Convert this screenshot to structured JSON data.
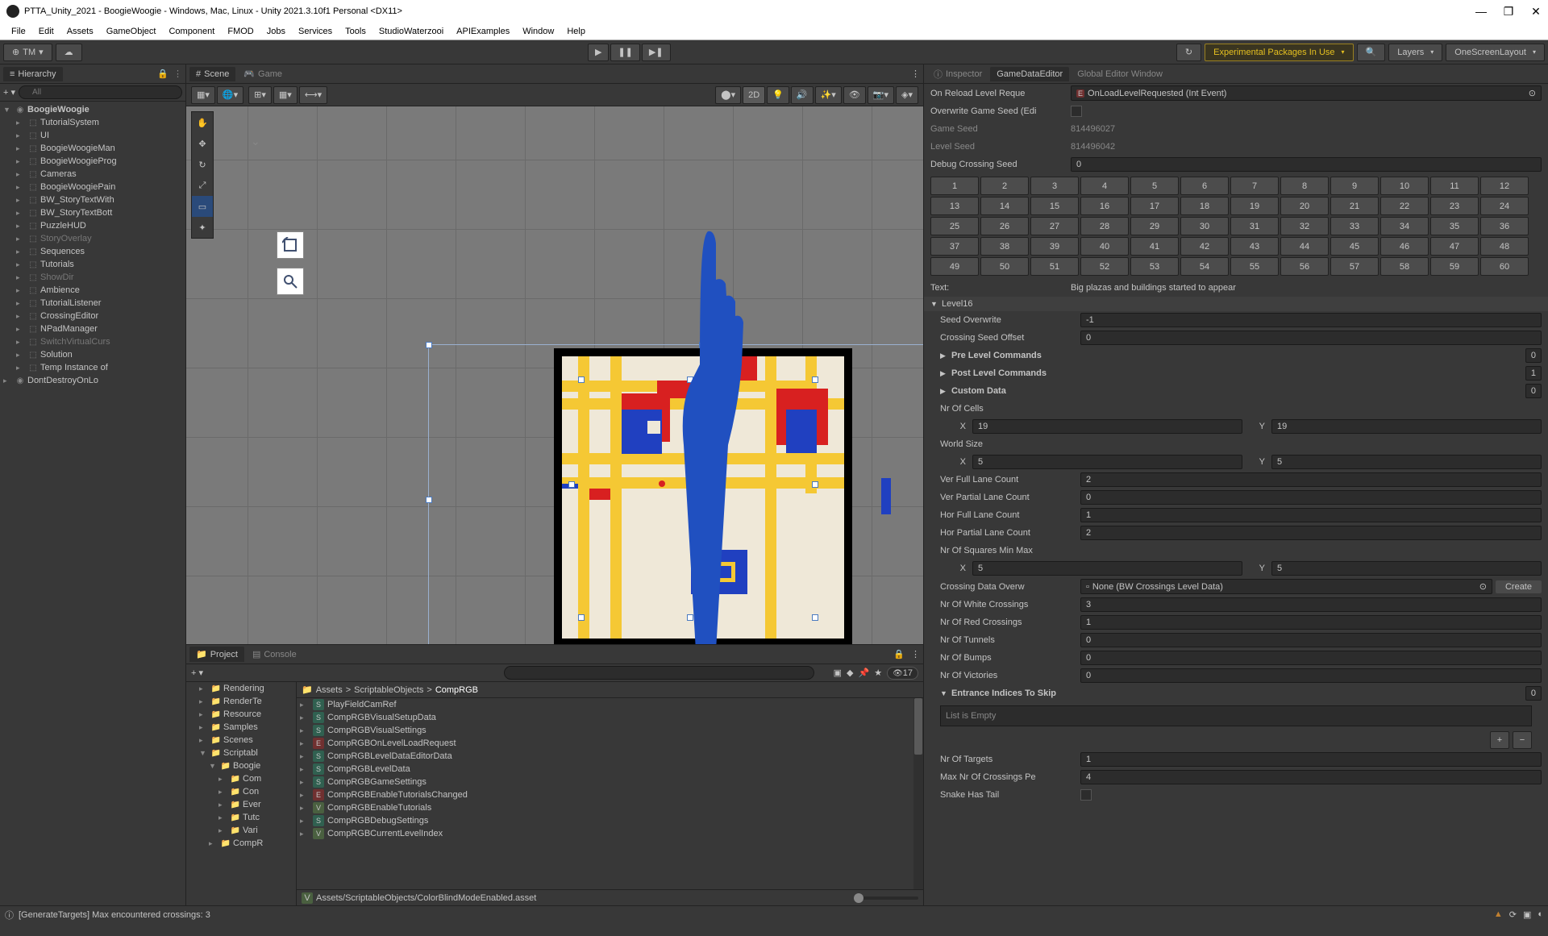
{
  "titlebar": {
    "title": "PTTA_Unity_2021 - BoogieWoogie - Windows, Mac, Linux - Unity 2021.3.10f1 Personal <DX11>"
  },
  "menubar": [
    "File",
    "Edit",
    "Assets",
    "GameObject",
    "Component",
    "FMOD",
    "Jobs",
    "Services",
    "Tools",
    "StudioWaterzooi",
    "APIExamples",
    "Window",
    "Help"
  ],
  "toolbar": {
    "account": "TM",
    "packages_warning": "Experimental Packages In Use",
    "layers": "Layers",
    "layout": "OneScreenLayout"
  },
  "hierarchy": {
    "title": "Hierarchy",
    "search_placeholder": "All",
    "items": [
      {
        "name": "BoogieWoogie",
        "depth": 0,
        "icon": "unity",
        "expanded": true,
        "bold": true
      },
      {
        "name": "TutorialSystem",
        "depth": 1,
        "icon": "cube"
      },
      {
        "name": "UI",
        "depth": 1,
        "icon": "cube"
      },
      {
        "name": "BoogieWoogieMan",
        "depth": 1,
        "icon": "cube",
        "truncated": true
      },
      {
        "name": "BoogieWoogieProg",
        "depth": 1,
        "icon": "cube",
        "truncated": true
      },
      {
        "name": "Cameras",
        "depth": 1,
        "icon": "cube"
      },
      {
        "name": "BoogieWoogiePain",
        "depth": 1,
        "icon": "cube",
        "truncated": true
      },
      {
        "name": "BW_StoryTextWith",
        "depth": 1,
        "icon": "cube",
        "truncated": true
      },
      {
        "name": "BW_StoryTextBott",
        "depth": 1,
        "icon": "cube",
        "truncated": true
      },
      {
        "name": "PuzzleHUD",
        "depth": 1,
        "icon": "cube"
      },
      {
        "name": "StoryOverlay",
        "depth": 1,
        "icon": "cube",
        "dim": true
      },
      {
        "name": "Sequences",
        "depth": 1,
        "icon": "cube"
      },
      {
        "name": "Tutorials",
        "depth": 1,
        "icon": "cube"
      },
      {
        "name": "ShowDir",
        "depth": 1,
        "icon": "cube",
        "dim": true
      },
      {
        "name": "Ambience",
        "depth": 1,
        "icon": "cube"
      },
      {
        "name": "TutorialListener",
        "depth": 1,
        "icon": "cube"
      },
      {
        "name": "CrossingEditor",
        "depth": 1,
        "icon": "cube"
      },
      {
        "name": "NPadManager",
        "depth": 1,
        "icon": "cube"
      },
      {
        "name": "SwitchVirtualCurs",
        "depth": 1,
        "icon": "cube",
        "dim": true,
        "truncated": true
      },
      {
        "name": "Solution",
        "depth": 1,
        "icon": "cube"
      },
      {
        "name": "Temp Instance of",
        "depth": 1,
        "icon": "cube",
        "truncated": true
      },
      {
        "name": "DontDestroyOnLo",
        "depth": 0,
        "icon": "unity",
        "truncated": true
      }
    ]
  },
  "scene": {
    "tab_scene": "Scene",
    "tab_game": "Game",
    "mode_2d": "2D"
  },
  "project": {
    "tab_project": "Project",
    "tab_console": "Console",
    "hidden_count": "17",
    "breadcrumb": [
      "Assets",
      "ScriptableObjects",
      "CompRGB"
    ],
    "folders": [
      {
        "name": "Rendering",
        "depth": 1
      },
      {
        "name": "RenderTe",
        "depth": 1
      },
      {
        "name": "Resource",
        "depth": 1
      },
      {
        "name": "Samples",
        "depth": 1
      },
      {
        "name": "Scenes",
        "depth": 1
      },
      {
        "name": "Scriptabl",
        "depth": 1,
        "expanded": true
      },
      {
        "name": "Boogie",
        "depth": 2,
        "expanded": true
      },
      {
        "name": "Com",
        "depth": 3
      },
      {
        "name": "Con",
        "depth": 3
      },
      {
        "name": "Ever",
        "depth": 3
      },
      {
        "name": "Tutc",
        "depth": 3
      },
      {
        "name": "Vari",
        "depth": 3
      },
      {
        "name": "CompR",
        "depth": 2
      }
    ],
    "files": [
      {
        "name": "CompRGBCurrentLevelIndex",
        "icon": "V"
      },
      {
        "name": "CompRGBDebugSettings",
        "icon": "S"
      },
      {
        "name": "CompRGBEnableTutorials",
        "icon": "V"
      },
      {
        "name": "CompRGBEnableTutorialsChanged",
        "icon": "E"
      },
      {
        "name": "CompRGBGameSettings",
        "icon": "S"
      },
      {
        "name": "CompRGBLevelData",
        "icon": "S"
      },
      {
        "name": "CompRGBLevelDataEditorData",
        "icon": "S"
      },
      {
        "name": "CompRGBOnLevelLoadRequest",
        "icon": "E"
      },
      {
        "name": "CompRGBVisualSettings",
        "icon": "S"
      },
      {
        "name": "CompRGBVisualSetupData",
        "icon": "S"
      },
      {
        "name": "PlayFieldCamRef",
        "icon": "S"
      }
    ],
    "path": "Assets/ScriptableObjects/ColorBlindModeEnabled.asset",
    "path_icon": "V"
  },
  "inspector": {
    "tab_inspector": "Inspector",
    "tab_gamedata": "GameDataEditor",
    "tab_global": "Global Editor Window",
    "reload_label": "On Reload Level Reque",
    "reload_value": "OnLoadLevelRequested (Int Event)",
    "overwrite_label": "Overwrite Game Seed (Edi",
    "game_seed_label": "Game Seed",
    "game_seed_value": "814496027",
    "level_seed_label": "Level Seed",
    "level_seed_value": "814496042",
    "debug_crossing_label": "Debug Crossing Seed",
    "debug_crossing_value": "0",
    "numbers": [
      "1",
      "2",
      "3",
      "4",
      "5",
      "6",
      "7",
      "8",
      "9",
      "10",
      "11",
      "12",
      "13",
      "14",
      "15",
      "16",
      "17",
      "18",
      "19",
      "20",
      "21",
      "22",
      "23",
      "24",
      "25",
      "26",
      "27",
      "28",
      "29",
      "30",
      "31",
      "32",
      "33",
      "34",
      "35",
      "36",
      "37",
      "38",
      "39",
      "40",
      "41",
      "42",
      "43",
      "44",
      "45",
      "46",
      "47",
      "48",
      "49",
      "50",
      "51",
      "52",
      "53",
      "54",
      "55",
      "56",
      "57",
      "58",
      "59",
      "60"
    ],
    "text_label": "Text:",
    "text_value": "Big plazas and buildings started to appear",
    "level_name": "Level16",
    "seed_overwrite_label": "Seed Overwrite",
    "seed_overwrite_value": "-1",
    "crossing_offset_label": "Crossing Seed Offset",
    "crossing_offset_value": "0",
    "pre_level_label": "Pre Level Commands",
    "pre_level_count": "0",
    "post_level_label": "Post Level Commands",
    "post_level_count": "1",
    "custom_data_label": "Custom Data",
    "custom_data_count": "0",
    "nr_cells_label": "Nr Of Cells",
    "nr_cells_x": "19",
    "nr_cells_y": "19",
    "world_size_label": "World Size",
    "world_size_x": "5",
    "world_size_y": "5",
    "ver_full_label": "Ver Full Lane Count",
    "ver_full_value": "2",
    "ver_partial_label": "Ver Partial Lane Count",
    "ver_partial_value": "0",
    "hor_full_label": "Hor Full Lane Count",
    "hor_full_value": "1",
    "hor_partial_label": "Hor Partial Lane Count",
    "hor_partial_value": "2",
    "squares_label": "Nr Of Squares Min Max",
    "squares_x": "5",
    "squares_y": "5",
    "crossing_data_label": "Crossing Data Overw",
    "crossing_data_value": "None (BW Crossings Level Data)",
    "create_btn": "Create",
    "white_cross_label": "Nr Of White Crossings",
    "white_cross_value": "3",
    "red_cross_label": "Nr Of Red Crossings",
    "red_cross_value": "1",
    "tunnels_label": "Nr Of Tunnels",
    "tunnels_value": "0",
    "bumps_label": "Nr Of Bumps",
    "bumps_value": "0",
    "victories_label": "Nr Of Victories",
    "victories_value": "0",
    "entrance_label": "Entrance Indices To Skip",
    "entrance_count": "0",
    "list_empty": "List is Empty",
    "targets_label": "Nr Of Targets",
    "targets_value": "1",
    "max_cross_label": "Max Nr Of Crossings Pe",
    "max_cross_value": "4",
    "snake_tail_label": "Snake Has Tail"
  },
  "statusbar": {
    "message": "[GenerateTargets] Max encountered crossings: 3"
  }
}
